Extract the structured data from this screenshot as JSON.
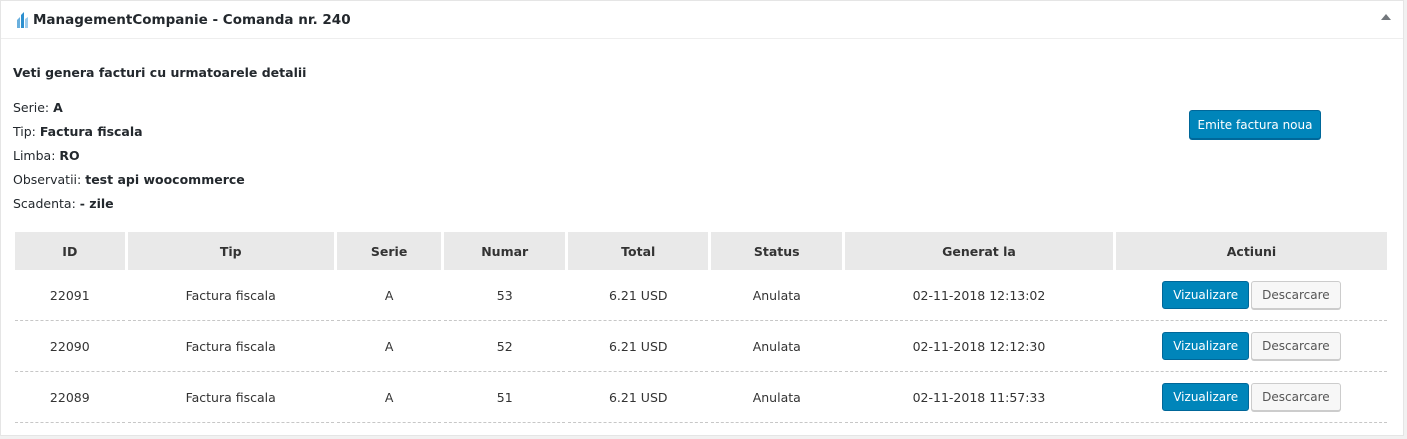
{
  "header": {
    "logo_icon": "building-icon",
    "title": "ManagementCompanie - Comanda nr. 240"
  },
  "intro": "Veti genera facturi cu urmatoarele detalii",
  "details": [
    {
      "label": "Serie: ",
      "value": "A"
    },
    {
      "label": "Tip: ",
      "value": "Factura fiscala"
    },
    {
      "label": "Limba: ",
      "value": "RO"
    },
    {
      "label": "Observatii: ",
      "value": "test api woocommerce"
    },
    {
      "label": "Scadenta: ",
      "value": "- zile"
    }
  ],
  "new_invoice_button": "Emite factura noua",
  "table": {
    "columns": [
      "ID",
      "Tip",
      "Serie",
      "Numar",
      "Total",
      "Status",
      "Generat la",
      "Actiuni"
    ],
    "rows": [
      {
        "id": "22091",
        "tip": "Factura fiscala",
        "serie": "A",
        "numar": "53",
        "total": "6.21 USD",
        "status": "Anulata",
        "generat": "02-11-2018 12:13:02",
        "view": "Vizualizare",
        "download": "Descarcare"
      },
      {
        "id": "22090",
        "tip": "Factura fiscala",
        "serie": "A",
        "numar": "52",
        "total": "6.21 USD",
        "status": "Anulata",
        "generat": "02-11-2018 12:12:30",
        "view": "Vizualizare",
        "download": "Descarcare"
      },
      {
        "id": "22089",
        "tip": "Factura fiscala",
        "serie": "A",
        "numar": "51",
        "total": "6.21 USD",
        "status": "Anulata",
        "generat": "02-11-2018 11:57:33",
        "view": "Vizualizare",
        "download": "Descarcare"
      }
    ]
  },
  "colors": {
    "primary": "#0085ba",
    "header_bg": "#e9e9e9"
  }
}
